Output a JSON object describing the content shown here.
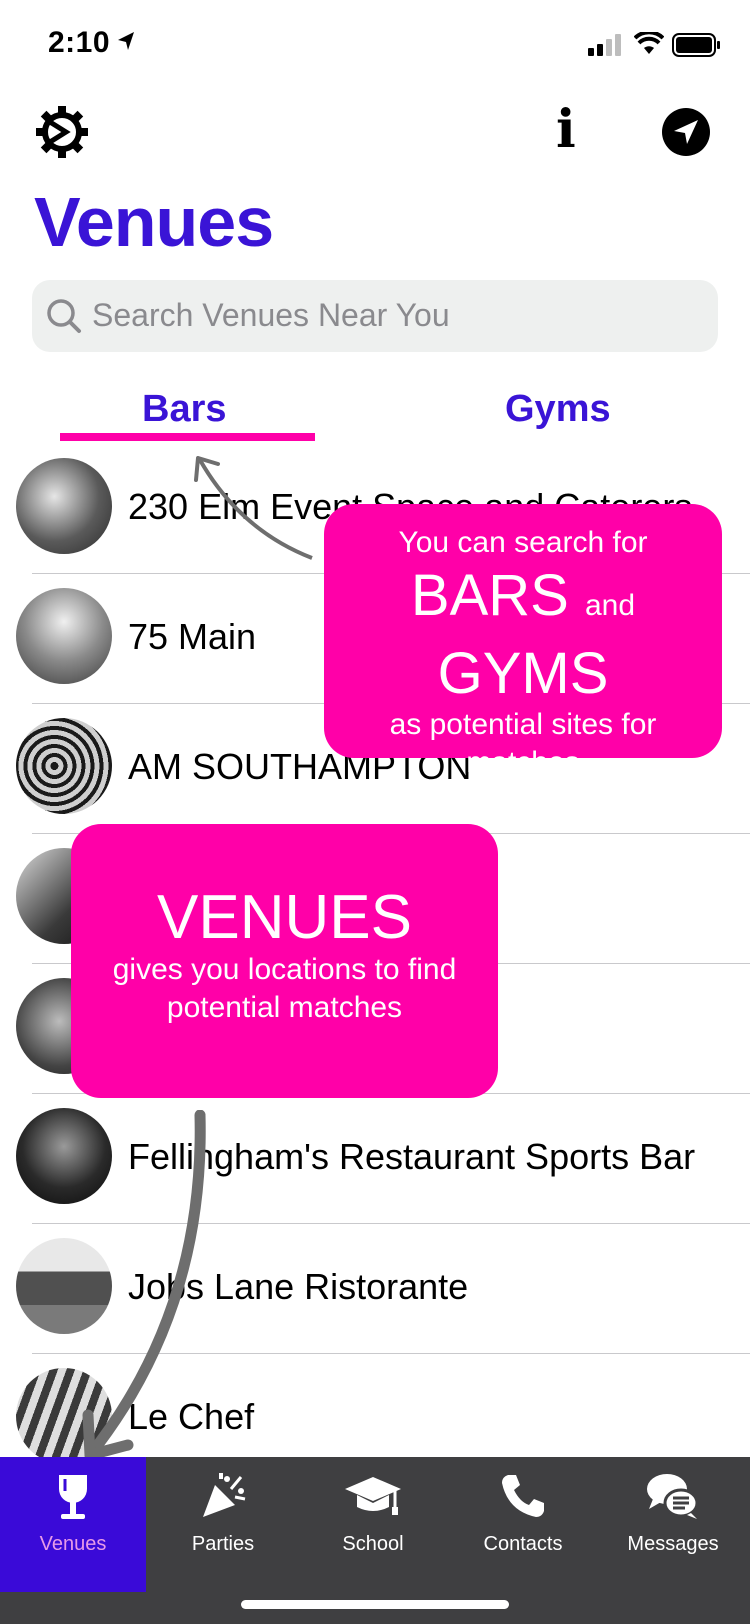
{
  "status_bar": {
    "time": "2:10"
  },
  "header": {
    "title": "Venues"
  },
  "search": {
    "placeholder": "Search Venues Near You"
  },
  "tabs": [
    {
      "label": "Bars",
      "active": true
    },
    {
      "label": "Gyms",
      "active": false
    }
  ],
  "venues": [
    {
      "name": "230 Elm Event Space and Caterers"
    },
    {
      "name": "75 Main"
    },
    {
      "name": "AM SOUTHAMPTON"
    },
    {
      "name": ""
    },
    {
      "name": ""
    },
    {
      "name": "Fellingham's Restaurant Sports Bar"
    },
    {
      "name": "Jobs Lane Ristorante"
    },
    {
      "name": "Le Chef"
    }
  ],
  "callouts": {
    "search_tip": {
      "line1": "You can search for",
      "big1": "BARS",
      "small_and": "and",
      "big2": "GYMS",
      "line3": "as potential sites for",
      "line4": "matches"
    },
    "venues_tip": {
      "heading": "VENUES",
      "line1": "gives you locations to find",
      "line2": "potential matches"
    }
  },
  "tab_bar": {
    "items": [
      {
        "label": "Venues",
        "icon": "wine-glass-icon",
        "active": true
      },
      {
        "label": "Parties",
        "icon": "party-popper-icon",
        "active": false
      },
      {
        "label": "School",
        "icon": "graduation-cap-icon",
        "active": false
      },
      {
        "label": "Contacts",
        "icon": "phone-icon",
        "active": false
      },
      {
        "label": "Messages",
        "icon": "chat-bubbles-icon",
        "active": false
      }
    ]
  },
  "colors": {
    "accent": "#3a14d6",
    "callout": "#ff00a8",
    "tab_bar_bg": "#3f3f41",
    "active_tab_bg": "#3a0ad8",
    "active_tab_label": "#e79ae8"
  }
}
